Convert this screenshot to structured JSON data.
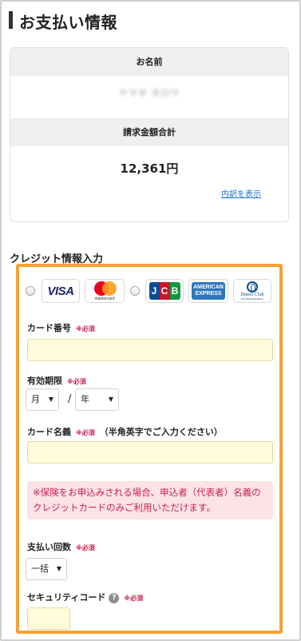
{
  "header": {
    "title": "お支払い情報"
  },
  "summary": {
    "name_label": "お名前",
    "name_value": "ヤマダ タロウ",
    "total_label": "請求金額合計",
    "total_value": "12,361円",
    "detail_link": "内訳を表示"
  },
  "credit": {
    "section_title": "クレジット情報入力",
    "cards": {
      "visa": "VISA",
      "mastercard": "mastercard",
      "jcb": [
        "J",
        "C",
        "B"
      ],
      "amex": [
        "AMERICAN",
        "EXPRESS"
      ],
      "diners": [
        "Diners Club",
        "INTERNATIONAL"
      ]
    },
    "required_mark": "※必須",
    "card_number_label": "カード番号",
    "card_number_value": "",
    "expiry_label": "有効期限",
    "expiry_month": "月",
    "expiry_separator": "/",
    "expiry_year": "年",
    "card_name_label": "カード名義",
    "card_name_note": "（半角英字でご入力ください）",
    "card_name_value": "",
    "notice": "※保険をお申込みされる場合、申込者（代表者）名義のクレジットカードのみご利用いただけます。",
    "installments_label": "支払い回数",
    "installments_value": "一括",
    "security_code_label": "セキュリティコード",
    "help_icon_text": "?",
    "dropdown_arrow": "▼"
  }
}
